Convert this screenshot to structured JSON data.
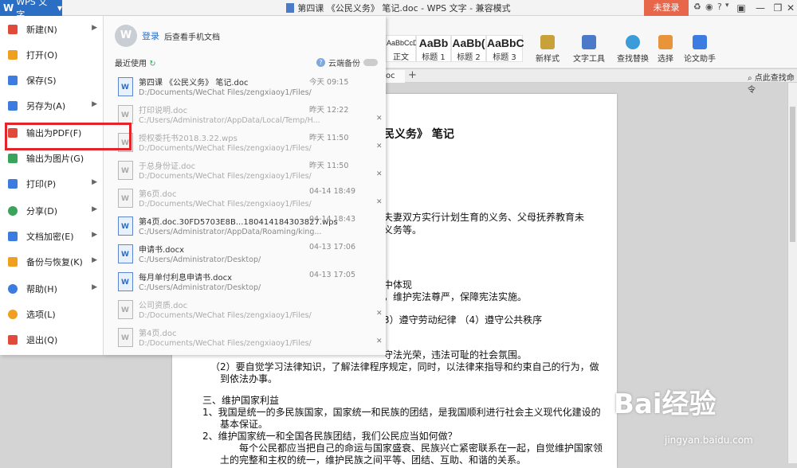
{
  "titlebar": {
    "app_label": "WPS 文字",
    "doc_title": "第四课 《公民义务》 笔记.doc - WPS 文字 - 兼容模式",
    "login": "未登录"
  },
  "ribbon": {
    "styles": [
      {
        "sample": "AaBbCcDd",
        "label": "正文"
      },
      {
        "sample": "AaBb",
        "label": "标题 1"
      },
      {
        "sample": "AaBb(",
        "label": "标题 2"
      },
      {
        "sample": "AaBbC",
        "label": "标题 3"
      }
    ],
    "tools": [
      "新样式",
      "文字工具",
      "查找替换",
      "选择",
      "论文助手"
    ]
  },
  "tabbar": {
    "tab_label": "oc",
    "hint": "点此查找命令"
  },
  "menu": {
    "items": [
      {
        "label": "新建(N)",
        "color": "#e04a3a"
      },
      {
        "label": "打开(O)",
        "color": "#f0a020"
      },
      {
        "label": "保存(S)",
        "color": "#3c7be0"
      },
      {
        "label": "另存为(A)",
        "color": "#3c7be0"
      },
      {
        "label": "输出为PDF(F)",
        "color": "#e04a3a"
      },
      {
        "label": "输出为图片(G)",
        "color": "#3aa55a"
      },
      {
        "label": "打印(P)",
        "color": "#3c7be0"
      },
      {
        "label": "分享(D)",
        "color": "#3aa55a"
      },
      {
        "label": "文档加密(E)",
        "color": "#3c7be0"
      },
      {
        "label": "备份与恢复(K)",
        "color": "#f0a020"
      },
      {
        "label": "帮助(H)",
        "color": "#3c7be0"
      },
      {
        "label": "选项(L)",
        "color": "#f0a020"
      },
      {
        "label": "退出(Q)",
        "color": "#e04a3a"
      }
    ]
  },
  "recent": {
    "login_link": "登录",
    "login_sub": "后查看手机文档",
    "header": "最近使用",
    "cloud": "云端备份",
    "files": [
      {
        "name": "第四课 《公民义务》 笔记.doc",
        "path": "D:/Documents/WeChat Files/zengxiaoy1/Files/",
        "date": "今天 09:15"
      },
      {
        "name": "打印说明.doc",
        "path": "C:/Users/Administrator/AppData/Local/Temp/H...",
        "date": "昨天 12:22"
      },
      {
        "name": "授权委托书2018.3.22.wps",
        "path": "D:/Documents/WeChat Files/zengxiaoy1/Files/",
        "date": "昨天 11:50"
      },
      {
        "name": "于总身份证.doc",
        "path": "D:/Documents/WeChat Files/zengxiaoy1/Files/",
        "date": "昨天 11:50"
      },
      {
        "name": "第6页.doc",
        "path": "D:/Documents/WeChat Files/zengxiaoy1/Files/",
        "date": "04-14 18:49"
      },
      {
        "name": "第4页.doc.30FD5703E8B...180414184303827.wps",
        "path": "C:/Users/Administrator/AppData/Roaming/king...",
        "date": "04-14 18:43"
      },
      {
        "name": "申请书.docx",
        "path": "C:/Users/Administrator/Desktop/",
        "date": "04-13 17:06"
      },
      {
        "name": "每月单付利息申请书.docx",
        "path": "C:/Users/Administrator/Desktop/",
        "date": "04-13 17:05"
      },
      {
        "name": "公司资质.doc",
        "path": "D:/Documents/WeChat Files/zengxiaoy1/Files/",
        "date": ""
      },
      {
        "name": "第4页.doc",
        "path": "D:/Documents/WeChat Files/zengxiaoy1/Files/",
        "date": ""
      }
    ]
  },
  "document": {
    "lines": [
      "民义务》 笔记",
      "夫妻双方实行计划生育的义务、父母抚养教育未",
      "义务等。",
      "中体现",
      "，维护宪法尊严，保障宪法实施。",
      "3）遵守劳动纪律   （4）遵守公共秩序",
      "守法光荣，违法可耻的社会氛围。",
      "（2）要自觉学习法律知识，了解法律程序规定，同时，以法律来指导和约束自己的行为，做",
      "到依法办事。",
      "三、维护国家利益",
      "1、我国是统一的多民族国家，国家统一和民族的团结，是我国顺利进行社会主义现代化建设的",
      "基本保证。",
      "2、维护国家统一和全国各民族团结，我们公民应当如何做？",
      "每个公民都应当把自己的命运与国家盛衰、民族兴亡紧密联系在一起，自觉维护国家领",
      "土的完整和主权的统一，维护民族之间平等、团结、互助、和谐的关系。"
    ]
  },
  "watermark": {
    "brand": "Bai经验",
    "url": "jingyan.baidu.com"
  }
}
